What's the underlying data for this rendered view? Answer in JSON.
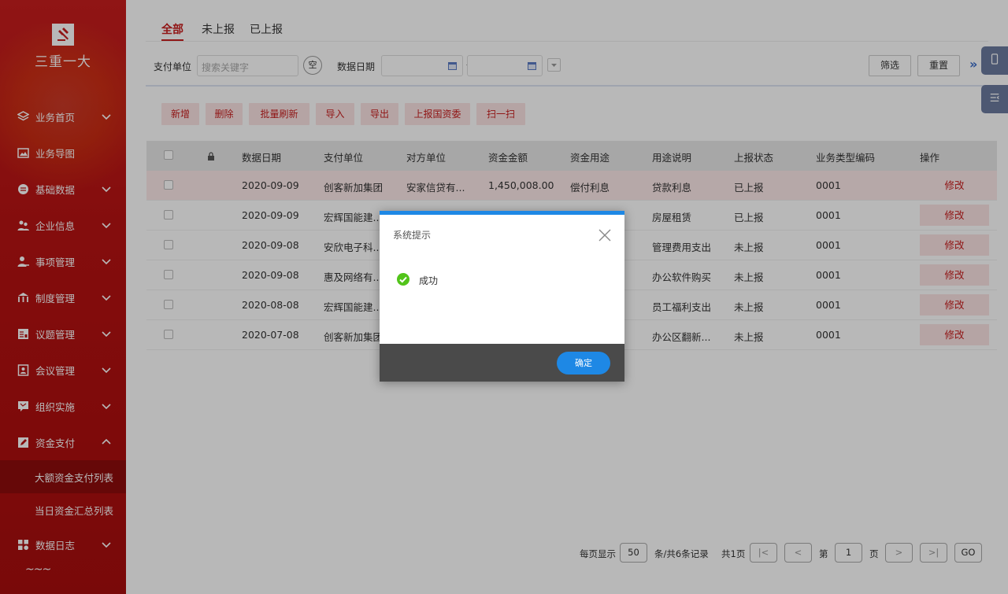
{
  "sidebar": {
    "logo_text": "三重一大",
    "items": [
      {
        "label": "业务首页",
        "icon": "layers-icon",
        "chevron": "down"
      },
      {
        "label": "业务导图",
        "icon": "image-icon",
        "chevron": ""
      },
      {
        "label": "基础数据",
        "icon": "database-icon",
        "chevron": "down"
      },
      {
        "label": "企业信息",
        "icon": "users-icon",
        "chevron": "down"
      },
      {
        "label": "事项管理",
        "icon": "user-edit-icon",
        "chevron": "down"
      },
      {
        "label": "制度管理",
        "icon": "org-icon",
        "chevron": "down"
      },
      {
        "label": "议题管理",
        "icon": "doc-icon",
        "chevron": "down"
      },
      {
        "label": "会议管理",
        "icon": "person-card-icon",
        "chevron": "down"
      },
      {
        "label": "组织实施",
        "icon": "flag-icon",
        "chevron": "down"
      },
      {
        "label": "资金支付",
        "icon": "edit-icon",
        "chevron": "up"
      }
    ],
    "subitems": [
      {
        "label": "大额资金支付列表",
        "active": true
      },
      {
        "label": "当日资金汇总列表",
        "active": false
      }
    ],
    "last_item": {
      "label": "数据日志",
      "icon": "grid-icon",
      "chevron": "down"
    },
    "more": "~~~"
  },
  "tabs": [
    "全部",
    "未上报",
    "已上报"
  ],
  "filter": {
    "unit_label": "支付单位",
    "unit_placeholder": "搜索关键字",
    "clear_label": "空",
    "date_label": "数据日期",
    "date_sep": "-",
    "filter_btn": "筛选",
    "reset_btn": "重置",
    "expand": "»"
  },
  "toolbar": [
    "新增",
    "删除",
    "批量刷新",
    "导入",
    "导出",
    "上报国资委",
    "扫一扫"
  ],
  "table": {
    "headers": [
      "数据日期",
      "支付单位",
      "对方单位",
      "资金金额",
      "资金用途",
      "用途说明",
      "上报状态",
      "业务类型编码",
      "操作"
    ],
    "rows": [
      {
        "date": "2020-09-09",
        "unit": "创客新加集团",
        "counter": "安家信贷有...",
        "amount": "1,450,008.00",
        "use": "偿付利息",
        "desc": "贷款利息",
        "status": "已上报",
        "code": "0001",
        "op": "修改"
      },
      {
        "date": "2020-09-09",
        "unit": "宏辉国能建...",
        "counter": "",
        "amount": "",
        "use": "",
        "desc": "房屋租赁",
        "status": "已上报",
        "code": "0001",
        "op": "修改"
      },
      {
        "date": "2020-09-08",
        "unit": "安欣电子科...",
        "counter": "",
        "amount": "",
        "use": "",
        "desc": "管理费用支出",
        "status": "未上报",
        "code": "0001",
        "op": "修改"
      },
      {
        "date": "2020-09-08",
        "unit": "惠及网络有...",
        "counter": "",
        "amount": "",
        "use": "",
        "desc": "办公软件购买",
        "status": "未上报",
        "code": "0001",
        "op": "修改"
      },
      {
        "date": "2020-08-08",
        "unit": "宏辉国能建...",
        "counter": "",
        "amount": "",
        "use": "",
        "desc": "员工福利支出",
        "status": "未上报",
        "code": "0001",
        "op": "修改"
      },
      {
        "date": "2020-07-08",
        "unit": "创客新加集团",
        "counter": "",
        "amount": "",
        "use": "",
        "desc": "办公区翻新...",
        "status": "未上报",
        "code": "0001",
        "op": "修改"
      }
    ]
  },
  "pager": {
    "per_page_label": "每页显示",
    "per_page": "50",
    "total_label": "条/共6条记录",
    "pages_label": "共1页",
    "first": "|<",
    "prev": "<",
    "page_prefix": "第",
    "page": "1",
    "page_suffix": "页",
    "next": ">",
    "last": ">|",
    "go": "GO"
  },
  "dialog": {
    "title": "系统提示",
    "message": "成功",
    "ok": "确定"
  },
  "colors": {
    "brand": "#c81e1e",
    "accent": "#1e88e5",
    "success": "#52c41a"
  }
}
